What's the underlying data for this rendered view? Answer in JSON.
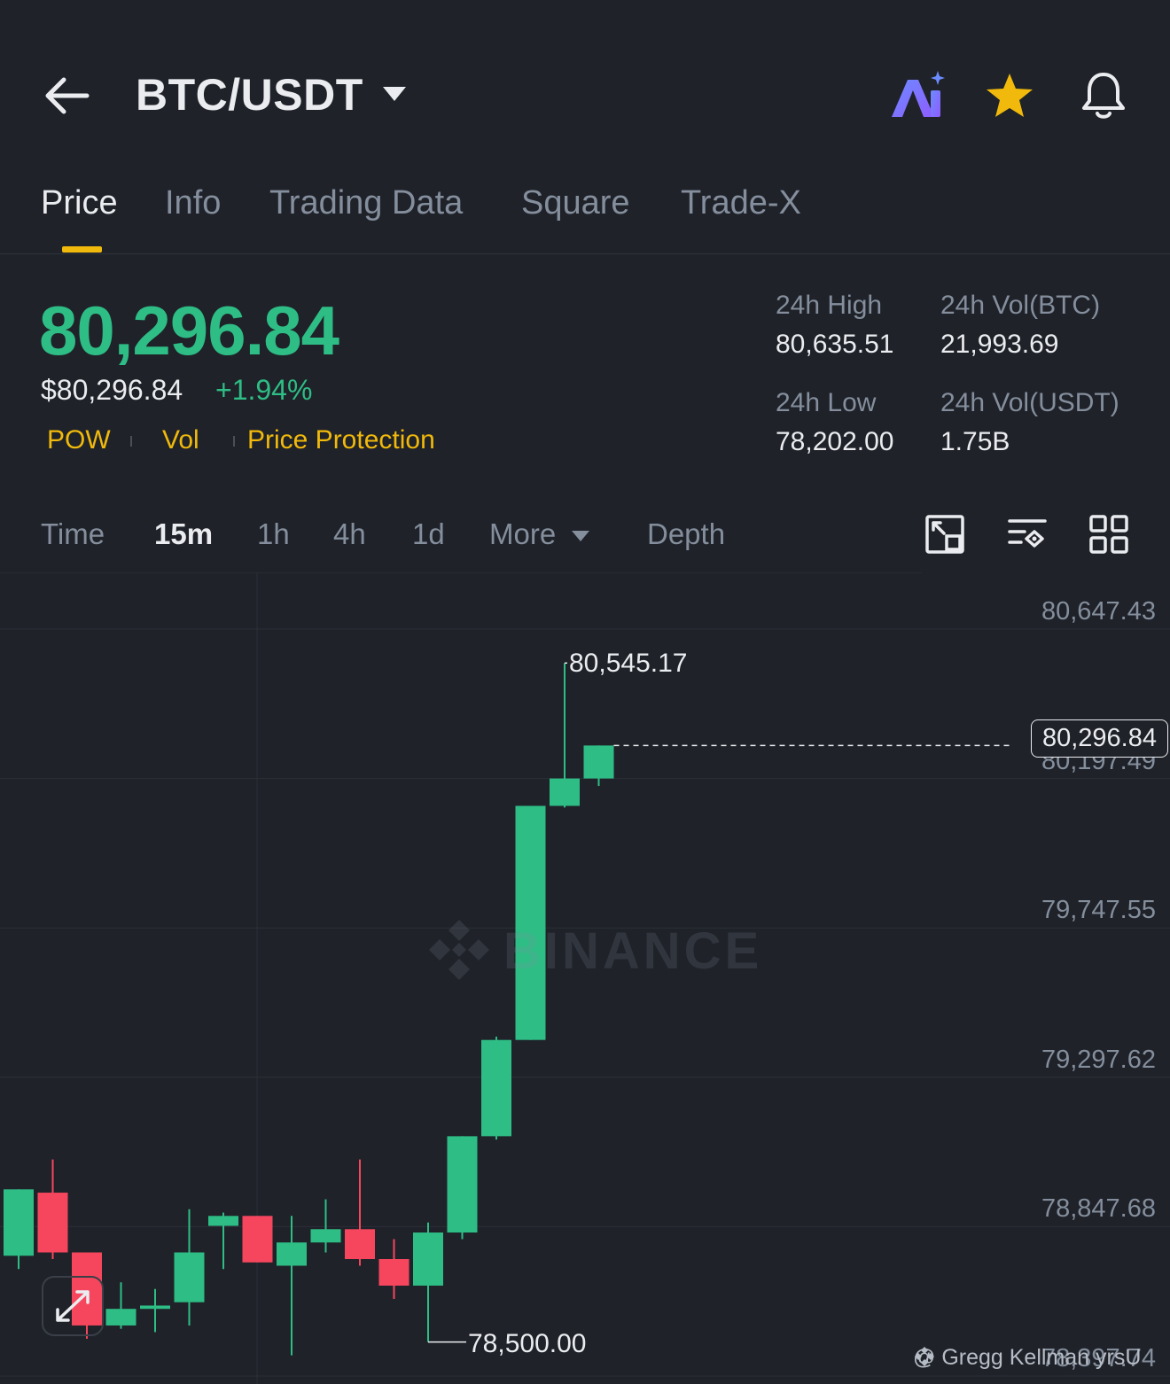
{
  "header": {
    "pair": "BTC/USDT",
    "icons": [
      "back-arrow-icon",
      "caret-down-icon",
      "ai-icon",
      "star-icon",
      "bell-icon"
    ]
  },
  "tabs": [
    {
      "label": "Price",
      "active": true
    },
    {
      "label": "Info",
      "active": false
    },
    {
      "label": "Trading Data",
      "active": false
    },
    {
      "label": "Square",
      "active": false
    },
    {
      "label": "Trade-X",
      "active": false
    }
  ],
  "price": {
    "last": "80,296.84",
    "usd": "$80,296.84",
    "change": "+1.94%",
    "tags": [
      "POW",
      "Vol",
      "Price Protection"
    ]
  },
  "stats": {
    "high_label": "24h High",
    "high_value": "80,635.51",
    "vol_btc_label": "24h Vol(BTC)",
    "vol_btc_value": "21,993.69",
    "low_label": "24h Low",
    "low_value": "78,202.00",
    "vol_usdt_label": "24h Vol(USDT)",
    "vol_usdt_value": "1.75B"
  },
  "timeframes": {
    "items": [
      {
        "label": "Time",
        "active": false
      },
      {
        "label": "15m",
        "active": true
      },
      {
        "label": "1h",
        "active": false
      },
      {
        "label": "4h",
        "active": false
      },
      {
        "label": "1d",
        "active": false
      }
    ],
    "more": "More",
    "depth": "Depth"
  },
  "colors": {
    "up": "#2ebd85",
    "down": "#f6465d",
    "accent": "#f0b90b",
    "background": "#1f2229"
  },
  "chart_data": {
    "type": "candlestick",
    "y_axis_labels": [
      "80,647.43",
      "80,197.49",
      "79,747.55",
      "79,297.62",
      "78,847.68",
      "78,397.74"
    ],
    "ylim": [
      78397.74,
      80647.43
    ],
    "current_price": "80,296.84",
    "high_marker": "80,545.17",
    "low_marker": "78,500.00",
    "watermark": "BINANCE",
    "candles": [
      {
        "o": 78760,
        "h": 78940,
        "l": 78720,
        "c": 78960
      },
      {
        "o": 78950,
        "h": 79050,
        "l": 78750,
        "c": 78770
      },
      {
        "o": 78770,
        "h": 78770,
        "l": 78510,
        "c": 78550
      },
      {
        "o": 78550,
        "h": 78680,
        "l": 78540,
        "c": 78600
      },
      {
        "o": 78600,
        "h": 78660,
        "l": 78530,
        "c": 78610
      },
      {
        "o": 78620,
        "h": 78900,
        "l": 78550,
        "c": 78770
      },
      {
        "o": 78850,
        "h": 78890,
        "l": 78720,
        "c": 78880
      },
      {
        "o": 78880,
        "h": 78880,
        "l": 78740,
        "c": 78740
      },
      {
        "o": 78730,
        "h": 78880,
        "l": 78460,
        "c": 78800
      },
      {
        "o": 78800,
        "h": 78930,
        "l": 78770,
        "c": 78840
      },
      {
        "o": 78840,
        "h": 79050,
        "l": 78730,
        "c": 78750
      },
      {
        "o": 78750,
        "h": 78810,
        "l": 78630,
        "c": 78670
      },
      {
        "o": 78670,
        "h": 78860,
        "l": 78500,
        "c": 78830
      },
      {
        "o": 78830,
        "h": 79120,
        "l": 78810,
        "c": 79120
      },
      {
        "o": 79120,
        "h": 79420,
        "l": 79110,
        "c": 79410
      },
      {
        "o": 79410,
        "h": 79470,
        "l": 79410,
        "c": 80115
      },
      {
        "o": 80115,
        "h": 80545.17,
        "l": 80110,
        "c": 80197.49
      },
      {
        "o": 80197.49,
        "h": 80297,
        "l": 80175,
        "c": 80296.84
      }
    ]
  },
  "footer": {
    "credit": "@ Gregg Kellman yrsU"
  }
}
